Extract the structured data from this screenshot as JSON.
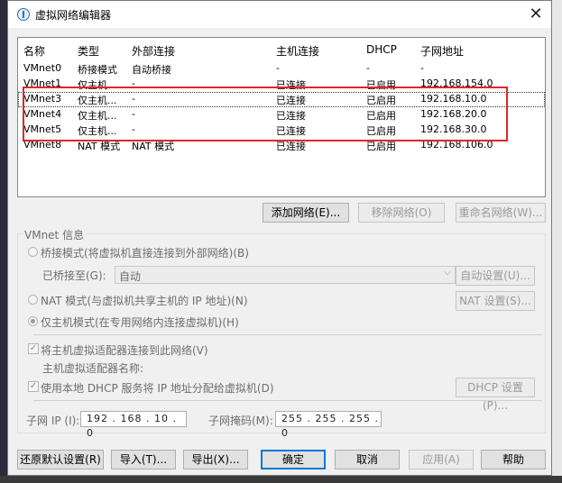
{
  "window": {
    "title": "虚拟网络编辑器",
    "close": "✕"
  },
  "table": {
    "headers": [
      "名称",
      "类型",
      "外部连接",
      "主机连接",
      "DHCP",
      "子网地址"
    ],
    "rows": [
      [
        "VMnet0",
        "桥接模式",
        "自动桥接",
        "-",
        "-",
        "-"
      ],
      [
        "VMnet1",
        "仅主机...",
        "-",
        "已连接",
        "已启用",
        "192.168.154.0"
      ],
      [
        "VMnet3",
        "仅主机...",
        "-",
        "已连接",
        "已启用",
        "192.168.10.0"
      ],
      [
        "VMnet4",
        "仅主机...",
        "-",
        "已连接",
        "已启用",
        "192.168.20.0"
      ],
      [
        "VMnet5",
        "仅主机...",
        "-",
        "已连接",
        "已启用",
        "192.168.30.0"
      ],
      [
        "VMnet8",
        "NAT 模式",
        "NAT 模式",
        "已连接",
        "已启用",
        "192.168.106.0"
      ]
    ]
  },
  "network_buttons": {
    "add": "添加网络(E)...",
    "remove": "移除网络(O)",
    "rename": "重命名网络(W)..."
  },
  "vmnet_info": {
    "label": "VMnet 信息",
    "bridge_mode": "桥接模式(将虚拟机直接连接到外部网络)(B)",
    "bridged_to_label": "已桥接至(G):",
    "bridged_to_value": "自动",
    "auto_settings": "自动设置(U)...",
    "nat_mode": "NAT 模式(与虚拟机共享主机的 IP 地址)(N)",
    "nat_settings": "NAT 设置(S)...",
    "host_only_mode": "仅主机模式(在专用网络内连接虚拟机)(H)",
    "connect_adapter": "将主机虚拟适配器连接到此网络(V)",
    "adapter_name_label": "主机虚拟适配器名称:",
    "use_dhcp": "使用本地 DHCP 服务将 IP 地址分配给虚拟机(D)",
    "dhcp_settings": "DHCP 设置(P)...",
    "subnet_ip_label": "子网 IP (I):",
    "subnet_ip_value": "192 . 168 . 10 . 0",
    "subnet_mask_label": "子网掩码(M):",
    "subnet_mask_value": "255 . 255 . 255 . 0"
  },
  "footer_buttons": {
    "restore": "还原默认设置(R)",
    "import": "导入(T)...",
    "export": "导出(X)...",
    "ok": "确定",
    "cancel": "取消",
    "apply": "应用(A)",
    "help": "帮助"
  }
}
